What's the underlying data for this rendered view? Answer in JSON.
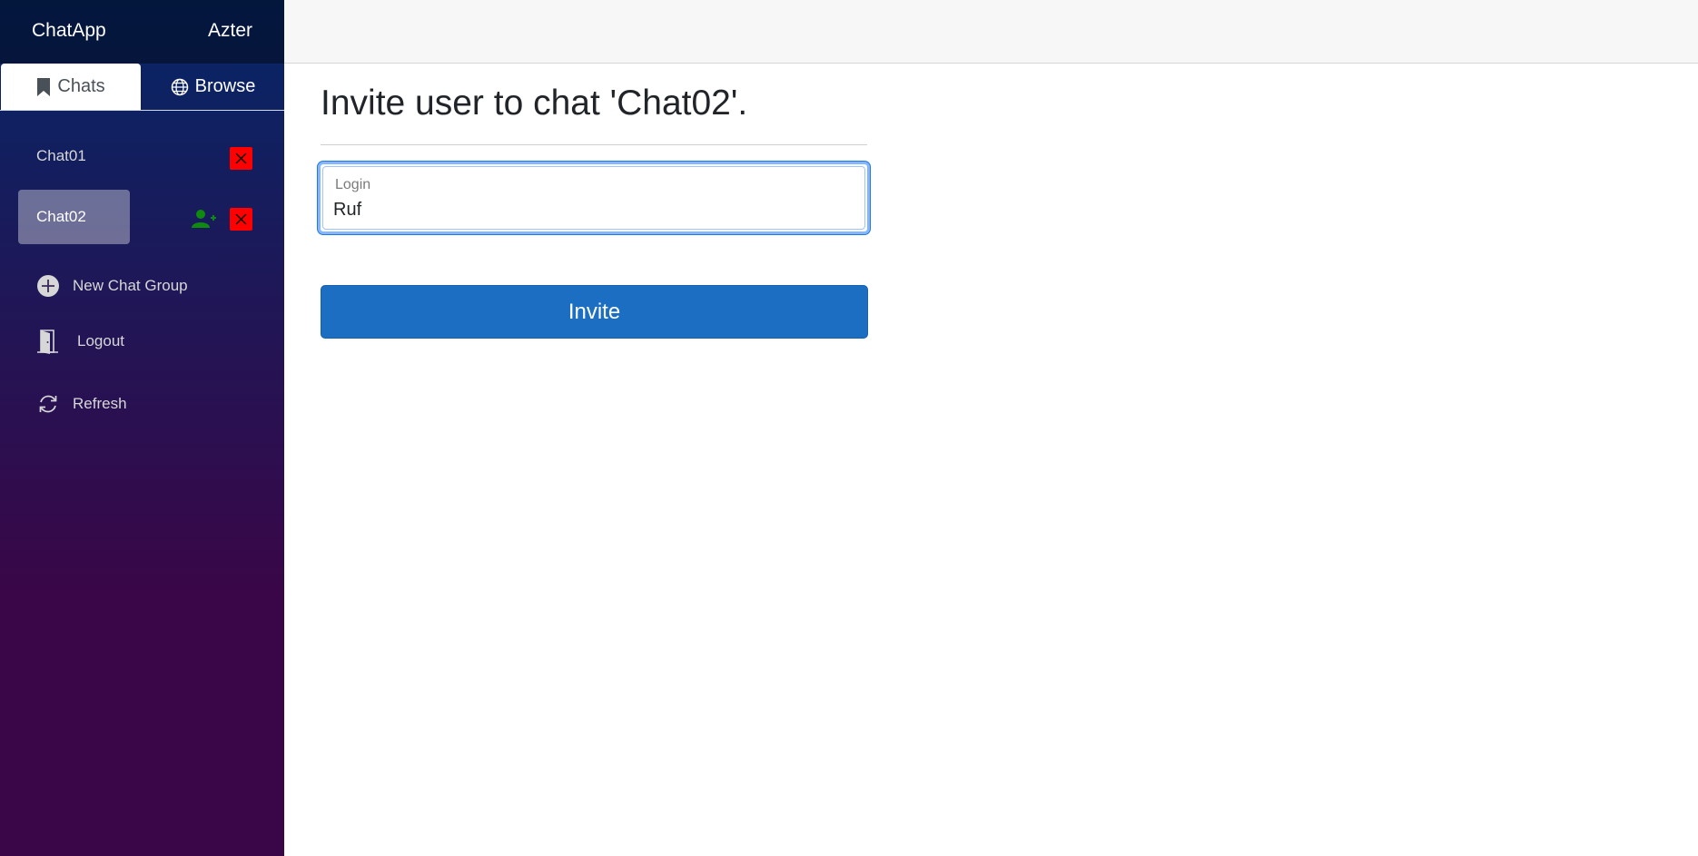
{
  "app": {
    "brand": "ChatApp",
    "username": "Azter"
  },
  "tabs": {
    "chats": "Chats",
    "browse": "Browse"
  },
  "chats": [
    {
      "name": "Chat01",
      "active": false
    },
    {
      "name": "Chat02",
      "active": true
    }
  ],
  "nav": {
    "new_chat_group": "New Chat Group",
    "logout": "Logout",
    "refresh": "Refresh"
  },
  "main": {
    "title": "Invite user to chat 'Chat02'.",
    "login_label": "Login",
    "login_value": "Ruf",
    "invite_button": "Invite"
  },
  "colors": {
    "sidebar_top": "#052767",
    "sidebar_bottom": "#3a0647",
    "delete_red": "#ff0000",
    "invite_green": "#0f8a0f",
    "primary_button": "#1b6ec2"
  },
  "icons": {
    "chats_tab": "bookmark-icon",
    "browse_tab": "globe-icon",
    "delete": "close-icon",
    "invite": "add-user-icon",
    "new_chat_group": "plus-circle-icon",
    "logout": "door-icon",
    "refresh": "refresh-icon"
  }
}
